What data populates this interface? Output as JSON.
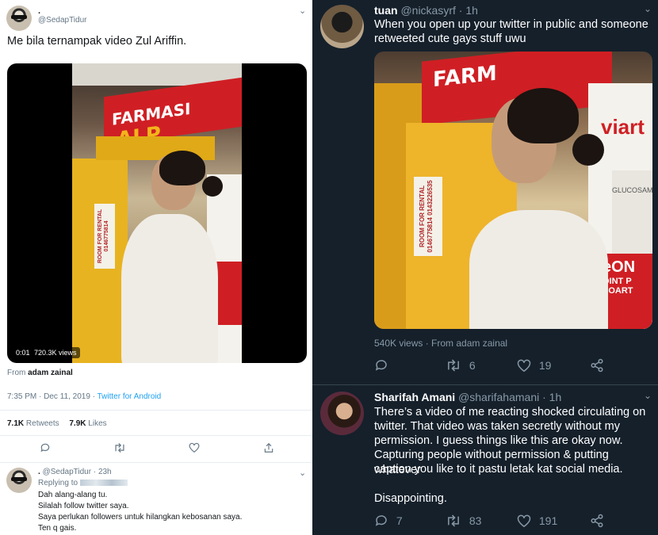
{
  "left": {
    "tweet": {
      "display_name": ".",
      "handle": "@SedapTidur",
      "text": "Me bila ternampak video Zul Ariffin.",
      "video_time": "0:01",
      "video_views": "720.3K views",
      "video_sign": "FARMASI",
      "video_sign2": "ALP",
      "video_notice": "ROOM FOR RENTAL 0146775814",
      "from_label": "From",
      "from_name": "adam zainal",
      "time": "7:35 PM",
      "sep": " · ",
      "date": "Dec 11, 2019",
      "client": "Twitter for Android",
      "retweets_count": "7.1K",
      "retweets_label": "Retweets",
      "likes_count": "7.9K",
      "likes_label": "Likes"
    },
    "reply": {
      "display_name": ".",
      "handle": "@SedapTidur",
      "time": "23h",
      "replying_to": "Replying to",
      "lines": [
        "Dah alang-alang tu.",
        "Silalah follow twitter saya.",
        "Saya perlukan followers untuk hilangkan kebosanan saya.",
        "Ten q gais."
      ]
    }
  },
  "right": {
    "tweet1": {
      "name": "tuan",
      "handle": "@nickasyrf",
      "time": "1h",
      "lines": [
        "When you open up your twitter in public and someone",
        "retweeted cute gays stuff uwu"
      ],
      "image_sign": "FARM",
      "image_notice": "ROOM FOR RENTAL 0146775814 0143226535",
      "image_side_1": "viart",
      "image_side_2": "GLUCOSAM",
      "image_side_3": "eON",
      "image_side_4": "OINT P",
      "image_side_5": "EOART",
      "views": "540K views",
      "from": "From adam zainal",
      "sep": " · ",
      "retweets": "6",
      "likes": "19"
    },
    "tweet2": {
      "name": "Sharifah Amani",
      "handle": "@sharifahamani",
      "time": "1h",
      "lines": [
        "There’s a video of me reacting shocked circulating on",
        "twitter. That video was taken secretly without my",
        "permission. I guess things like this are okay now.",
        "Capturing people without permission & putting whatever",
        "caption you like to it pastu letak kat social media."
      ],
      "closing": "Disappointing.",
      "replies": "7",
      "retweets": "83",
      "likes": "191"
    }
  },
  "colors": {
    "twitter_blue": "#1da1f2",
    "dark_bg": "#15202b",
    "dark_muted": "#8899a6",
    "light_muted": "#657786",
    "sign_red": "#cf1f24"
  },
  "icons": {
    "reply": "reply-icon",
    "retweet": "retweet-icon",
    "like": "heart-icon",
    "share": "share-icon",
    "chevron": "chevron-down-icon"
  }
}
